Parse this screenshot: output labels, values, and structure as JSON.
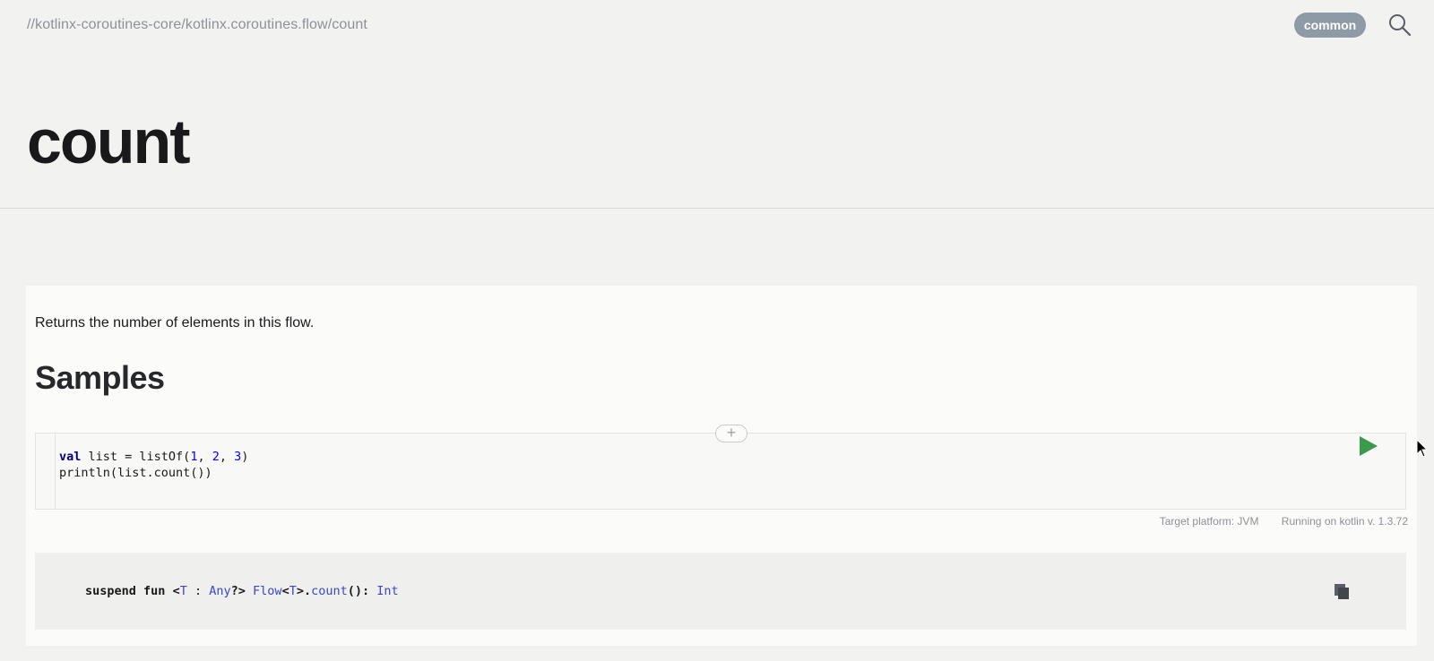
{
  "header": {
    "breadcrumb": "//kotlinx-coroutines-core/kotlinx.coroutines.flow/count",
    "platform_badge": "common",
    "search_icon": "search-icon"
  },
  "page": {
    "title": "count"
  },
  "content": {
    "description": "Returns the number of elements in this flow.",
    "samples_heading": "Samples",
    "code": {
      "line1_keyword": "val",
      "line1_rest_a": " list = listOf(",
      "line1_n1": "1",
      "line1_sep1": ", ",
      "line1_n2": "2",
      "line1_sep2": ", ",
      "line1_n3": "3",
      "line1_end": ")",
      "line2": "println(list.count())"
    },
    "expand_icon": "plus-icon",
    "run_icon": "play-icon",
    "footer": {
      "target_platform": "Target platform: JVM",
      "running_on": "Running on kotlin v. 1.3.72"
    },
    "signature": {
      "suspend": "suspend",
      "fun": "fun",
      "lt": "<",
      "T1": "T",
      "colon": " : ",
      "any": "Any",
      "q_gt": "?>",
      "flow": "Flow",
      "lt2": "<",
      "T2": "T",
      "gt_dot": ">.",
      "count": "count",
      "parens": "(): ",
      "int": "Int"
    },
    "copy_icon": "copy-icon"
  },
  "colors": {
    "accent_badge": "#8e9aa6",
    "run_green": "#3c9a4c",
    "type_link": "#3a47c6"
  }
}
